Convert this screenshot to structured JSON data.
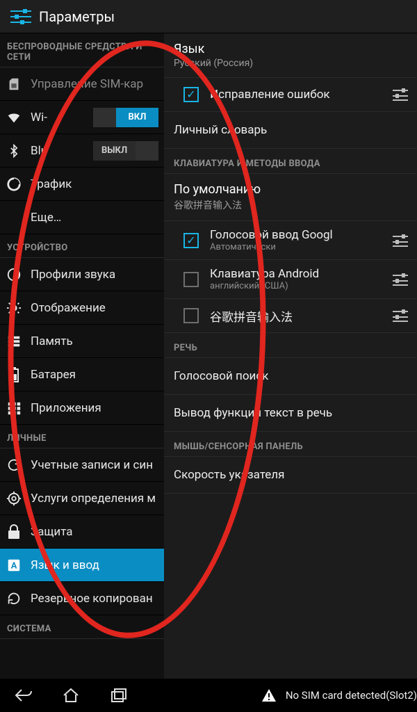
{
  "header": {
    "title": "Параметры"
  },
  "left": {
    "sections": [
      {
        "header": "БЕСПРОВОДНЫЕ СРЕДСТВА И СЕТИ",
        "items": [
          {
            "label": "Управление SIM-кар",
            "icon": "sim",
            "dim": true
          },
          {
            "label": "Wi-",
            "icon": "wifi",
            "toggle": "on",
            "toggle_on": "ВКЛ",
            "toggle_off": ""
          },
          {
            "label": "Blu",
            "icon": "bluetooth",
            "toggle": "off",
            "toggle_on": "",
            "toggle_off": "ВЫКЛ"
          },
          {
            "label": "Трафик",
            "icon": "data"
          },
          {
            "label": "Еще…",
            "icon": ""
          }
        ]
      },
      {
        "header": "УСТРОЙСТВО",
        "items": [
          {
            "label": "Профили звука",
            "icon": "sound"
          },
          {
            "label": "Отображение",
            "icon": "display"
          },
          {
            "label": "Память",
            "icon": "storage"
          },
          {
            "label": "Батарея",
            "icon": "battery"
          },
          {
            "label": "Приложения",
            "icon": "apps"
          }
        ]
      },
      {
        "header": "ЛИЧНЫЕ",
        "items": [
          {
            "label": "Учетные записи и син",
            "icon": "sync"
          },
          {
            "label": "Услуги определения м",
            "icon": "location"
          },
          {
            "label": "Защита",
            "icon": "lock"
          },
          {
            "label": "Язык и ввод",
            "icon": "lang",
            "selected": true
          },
          {
            "label": "Резервное копирован",
            "icon": "backup"
          }
        ]
      },
      {
        "header": "СИСТЕМА",
        "items": []
      }
    ]
  },
  "right": {
    "language": {
      "title": "Язык",
      "sub": "Русский (Россия)"
    },
    "spell": {
      "label": "Исправление ошибок",
      "checked": true
    },
    "dict": {
      "label": "Личный словарь"
    },
    "kb_section": "КЛАВИАТУРА И МЕТОДЫ ВВОДА",
    "default": {
      "title": "По умолчанию",
      "sub": "谷歌拼音输入法"
    },
    "imes": [
      {
        "label": "Голосовой ввод Googl",
        "sub": "Автоматически",
        "checked": true
      },
      {
        "label": "Клавиатура Android",
        "sub": "английский (США)",
        "checked": false
      },
      {
        "label": "谷歌拼音输入法",
        "sub": "",
        "checked": false
      }
    ],
    "speech_section": "РЕЧЬ",
    "voice_search": "Голосовой поиск",
    "tts": "Вывод функции текст в речь",
    "mouse_section": "МЫШЬ/СЕНСОРНАЯ ПАНЕЛЬ",
    "pointer": "Скорость указателя"
  },
  "navbar": {
    "warning": "No SIM card detected(Slot2)"
  }
}
